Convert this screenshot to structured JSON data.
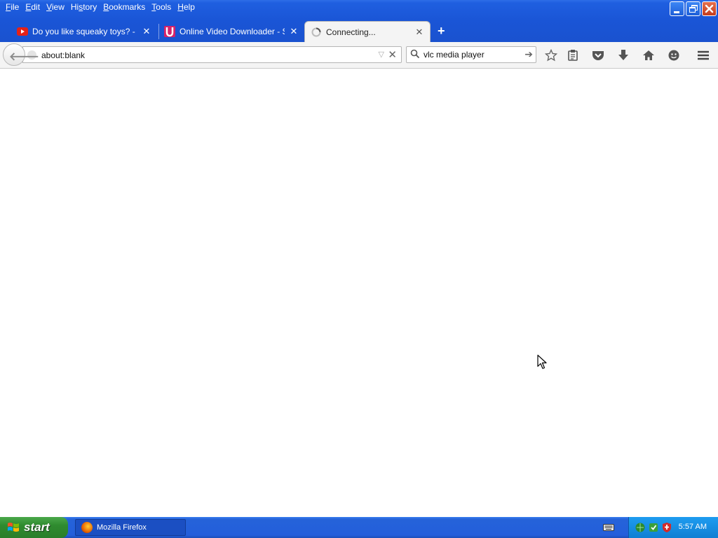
{
  "menu": [
    {
      "label": "File",
      "u": "F",
      "rest": "ile"
    },
    {
      "label": "Edit",
      "u": "E",
      "rest": "dit"
    },
    {
      "label": "View",
      "u": "V",
      "rest": "iew"
    },
    {
      "label": "History",
      "u": "",
      "pre": "Hi",
      "u2": "s",
      "rest": "tory"
    },
    {
      "label": "Bookmarks",
      "u": "B",
      "rest": "ookmarks"
    },
    {
      "label": "Tools",
      "u": "T",
      "rest": "ools"
    },
    {
      "label": "Help",
      "u": "H",
      "rest": "elp"
    }
  ],
  "tabs": [
    {
      "title": "Do you like squeaky toys? - Y...",
      "icon": "youtube-icon"
    },
    {
      "title": "Online Video Downloader - SS...",
      "icon": "savefrom-icon"
    },
    {
      "title": "Connecting...",
      "icon": "loading-spinner-icon"
    }
  ],
  "navbar": {
    "url": "about:blank",
    "search_value": "vlc media player"
  },
  "taskbar": {
    "start_label": "start",
    "window_label": "Mozilla Firefox",
    "clock": "5:57 AM"
  },
  "colors": {
    "titlebar": "#1a55d6",
    "taskbar": "#245edb",
    "tray": "#0f7fd3",
    "start": "#2f8b2f"
  }
}
